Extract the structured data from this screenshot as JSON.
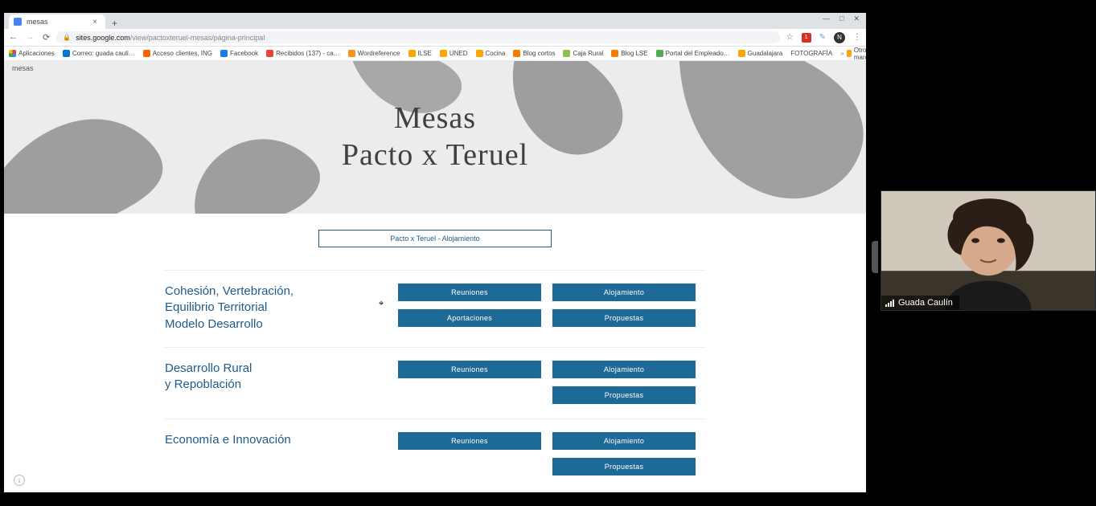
{
  "browser": {
    "tab_title": "mesas",
    "url_domain": "sites.google.com",
    "url_path": "/view/pactoxteruel-mesas/página-principal",
    "new_tab": "+",
    "win_min": "—",
    "win_max": "□",
    "win_close": "✕",
    "back": "←",
    "forward": "→",
    "reload": "⟳",
    "star": "☆",
    "ext_count": "1",
    "menu": "⋮"
  },
  "bookmarks": {
    "apps": "Aplicaciones",
    "items": [
      "Correo: guada cauli…",
      "Acceso clientes, ING",
      "Facebook",
      "Recibidos (137) - ca…",
      "Wordreference",
      "ILSE",
      "UNED",
      "Cocina",
      "Blog cortos",
      "Caja Rural",
      "Blog LSE",
      "Portal del Empleado…",
      "Guadalajara",
      "FOTOGRAFÍA"
    ],
    "other": "Otros marcadores"
  },
  "page": {
    "site_name": "mesas",
    "hero_line1": "Mesas",
    "hero_line2": "Pacto x Teruel",
    "pill": "Pacto x Teruel - Alojamiento",
    "btn_reuniones": "Reuniones",
    "btn_alojamiento": "Alojamiento",
    "btn_aportaciones": "Aportaciones",
    "btn_propuestas": "Propuestas",
    "sections": [
      {
        "title_html": "Cohesión, Vertebración,\nEquilibrio Territorial\n Modelo Desarrollo",
        "buttons": [
          "Reuniones",
          "Alojamiento",
          "Aportaciones",
          "Propuestas"
        ]
      },
      {
        "title_html": "Desarrollo Rural\ny Repoblación",
        "buttons": [
          "Reuniones",
          "Alojamiento",
          "Propuestas"
        ]
      },
      {
        "title_html": "Economía e Innovación",
        "buttons": [
          "Reuniones",
          "Alojamiento",
          "Propuestas"
        ]
      }
    ],
    "info": "i"
  },
  "video": {
    "name": "Guada Caulín"
  }
}
